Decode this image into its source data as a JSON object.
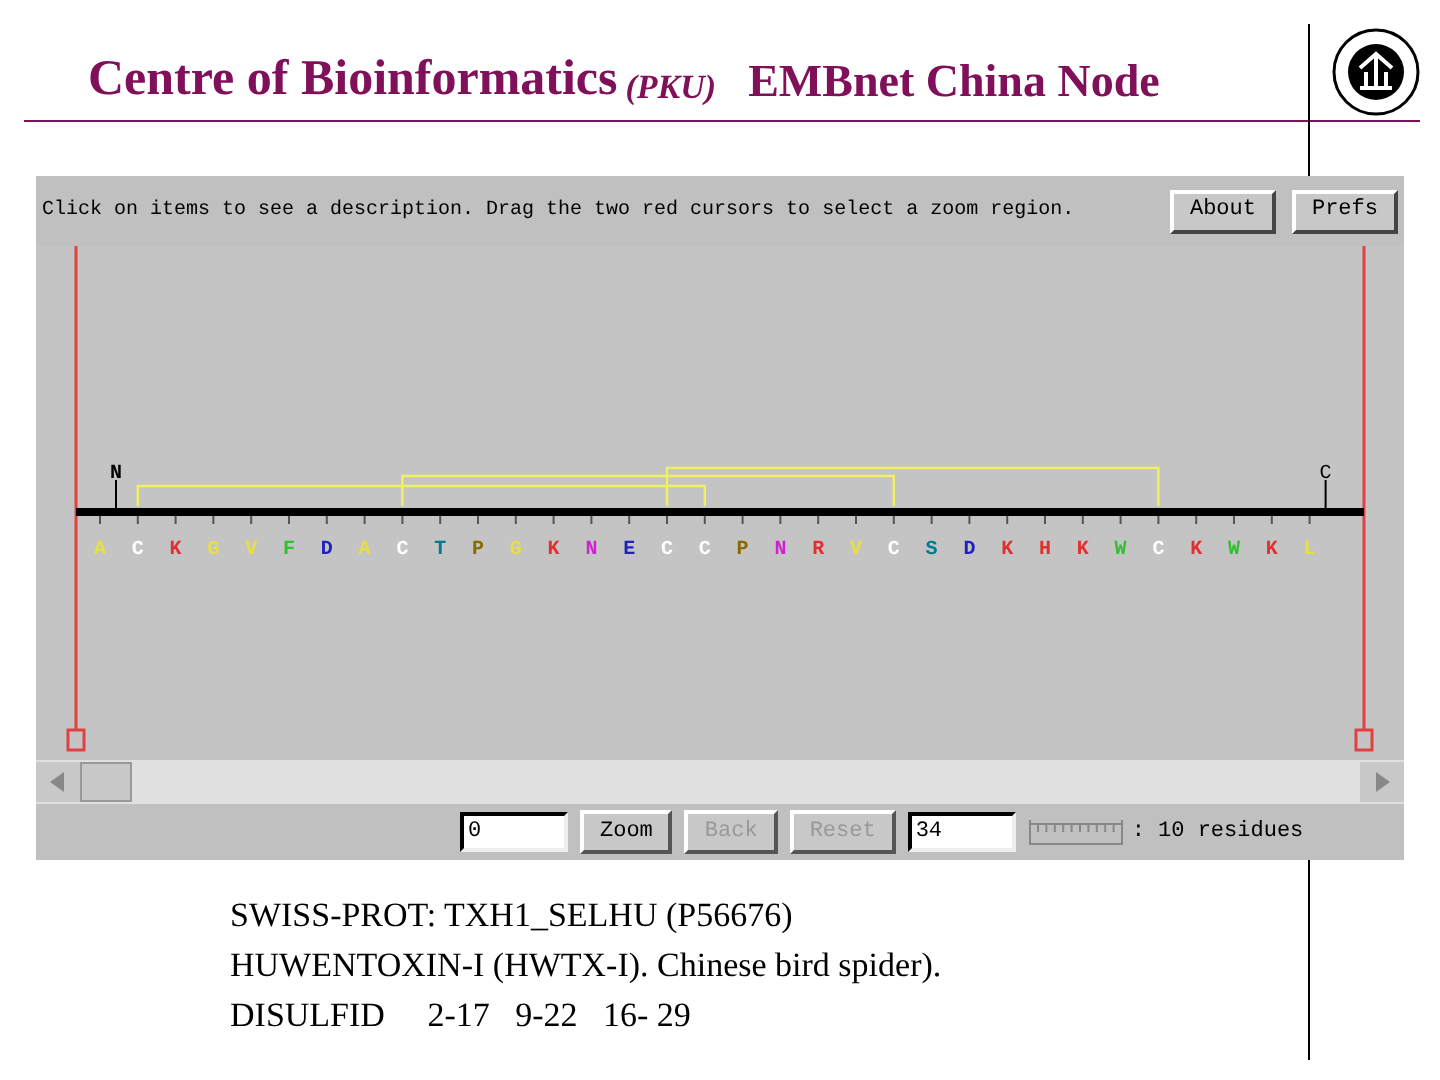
{
  "header": {
    "title": "Centre of Bioinformatics",
    "affiliation": "(PKU)",
    "node": "EMBnet China Node"
  },
  "applet": {
    "instruction": "Click on items to see a description. Drag the two red cursors to select a zoom region.",
    "buttons": [
      "About",
      "Prefs"
    ],
    "sequence": {
      "n_label": "N",
      "c_label": "C",
      "residues": [
        {
          "letter": "A",
          "color": "#e8e040",
          "bonded": false
        },
        {
          "letter": "C",
          "color": "#ffffff",
          "bonded": true
        },
        {
          "letter": "K",
          "color": "#e03030",
          "bonded": false
        },
        {
          "letter": "G",
          "color": "#e8e040",
          "bonded": false
        },
        {
          "letter": "V",
          "color": "#e8e040",
          "bonded": false
        },
        {
          "letter": "F",
          "color": "#30c030",
          "bonded": false
        },
        {
          "letter": "D",
          "color": "#2020c0",
          "bonded": false
        },
        {
          "letter": "A",
          "color": "#e8e040",
          "bonded": false
        },
        {
          "letter": "C",
          "color": "#ffffff",
          "bonded": true
        },
        {
          "letter": "T",
          "color": "#007c8c",
          "bonded": false
        },
        {
          "letter": "P",
          "color": "#8a6a00",
          "bonded": false
        },
        {
          "letter": "G",
          "color": "#e8e040",
          "bonded": false
        },
        {
          "letter": "K",
          "color": "#e03030",
          "bonded": false
        },
        {
          "letter": "N",
          "color": "#d020d0",
          "bonded": false
        },
        {
          "letter": "E",
          "color": "#2020c0",
          "bonded": false
        },
        {
          "letter": "C",
          "color": "#ffffff",
          "bonded": true
        },
        {
          "letter": "C",
          "color": "#ffffff",
          "bonded": true
        },
        {
          "letter": "P",
          "color": "#8a6a00",
          "bonded": false
        },
        {
          "letter": "N",
          "color": "#d020d0",
          "bonded": false
        },
        {
          "letter": "R",
          "color": "#e03030",
          "bonded": false
        },
        {
          "letter": "V",
          "color": "#e8e040",
          "bonded": false
        },
        {
          "letter": "C",
          "color": "#ffffff",
          "bonded": true
        },
        {
          "letter": "S",
          "color": "#007c8c",
          "bonded": false
        },
        {
          "letter": "D",
          "color": "#2020c0",
          "bonded": false
        },
        {
          "letter": "K",
          "color": "#e03030",
          "bonded": false
        },
        {
          "letter": "H",
          "color": "#e03030",
          "bonded": false
        },
        {
          "letter": "K",
          "color": "#e03030",
          "bonded": false
        },
        {
          "letter": "W",
          "color": "#30c030",
          "bonded": false
        },
        {
          "letter": "C",
          "color": "#ffffff",
          "bonded": true
        },
        {
          "letter": "K",
          "color": "#e03030",
          "bonded": false
        },
        {
          "letter": "W",
          "color": "#30c030",
          "bonded": false
        },
        {
          "letter": "K",
          "color": "#e03030",
          "bonded": false
        },
        {
          "letter": "L",
          "color": "#e8e040",
          "bonded": false
        }
      ]
    },
    "controls": [
      {
        "kind": "field",
        "value": "0"
      },
      {
        "kind": "button",
        "label": "Zoom",
        "disabled": false
      },
      {
        "kind": "button",
        "label": "Back",
        "disabled": true
      },
      {
        "kind": "button",
        "label": "Reset",
        "disabled": true
      },
      {
        "kind": "field",
        "value": "34"
      },
      {
        "kind": "scale",
        "label": ": 10 residues"
      }
    ]
  },
  "info": [
    "SWISS-PROT: TXH1_SELHU (P56676)",
    "HUWENTOXIN-I (HWTX-I). Chinese bird spider).",
    "DISULFID     2-17   9-22   16- 29"
  ]
}
